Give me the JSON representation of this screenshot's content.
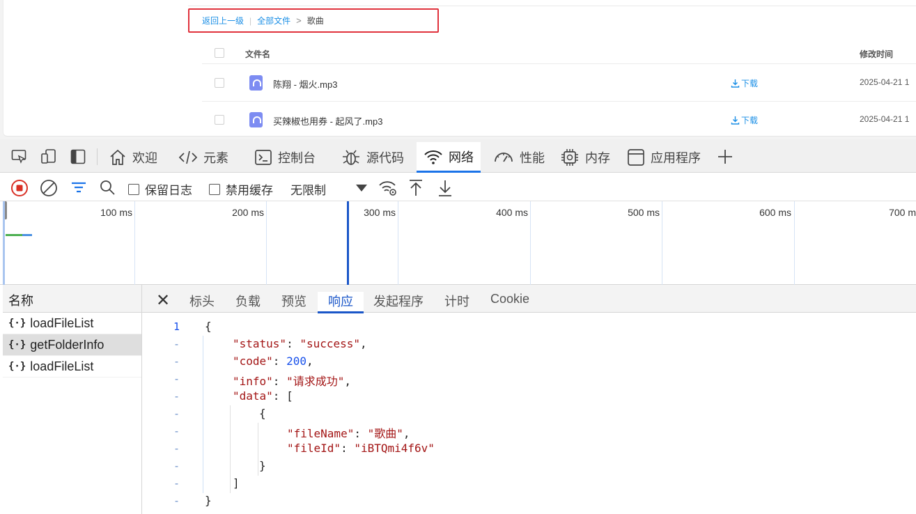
{
  "webpage": {
    "breadcrumb": {
      "back": "返回上一级",
      "all_files": "全部文件",
      "current": "歌曲"
    },
    "table": {
      "col_name": "文件名",
      "col_mtime": "修改时间",
      "rows": [
        {
          "name": "陈翔 - 烟火.mp3",
          "download": "下载",
          "mtime": "2025-04-21 1"
        },
        {
          "name": "买辣椒也用券 - 起风了.mp3",
          "download": "下载",
          "mtime": "2025-04-21 1"
        }
      ]
    }
  },
  "devtools": {
    "tabs": [
      "欢迎",
      "元素",
      "控制台",
      "源代码",
      "网络",
      "性能",
      "内存",
      "应用程序"
    ],
    "active_tab": "网络",
    "toolbar": {
      "preserve_log": "保留日志",
      "disable_cache": "禁用缓存",
      "throttle": "无限制"
    },
    "timeline_ticks": [
      "100 ms",
      "200 ms",
      "300 ms",
      "400 ms",
      "500 ms",
      "600 ms",
      "700 m"
    ],
    "requests_header": "名称",
    "requests": [
      "loadFileList",
      "getFolderInfo",
      "loadFileList"
    ],
    "selected_request": "getFolderInfo",
    "detail_tabs": [
      "标头",
      "负载",
      "预览",
      "响应",
      "发起程序",
      "计时",
      "Cookie"
    ],
    "active_detail_tab": "响应",
    "response": {
      "status": "success",
      "code": 200,
      "info": "请求成功",
      "data": [
        {
          "fileName": "歌曲",
          "fileId": "iBTQmi4f6v"
        }
      ]
    },
    "line_numbers": [
      "1",
      "-",
      "-",
      "-",
      "-",
      "-",
      "-",
      "-",
      "-",
      "-",
      "-"
    ]
  },
  "colors": {
    "accent": "#1a73e8",
    "link": "#1b8fe6",
    "highlight_box": "#e0323c",
    "record": "#d93025"
  }
}
